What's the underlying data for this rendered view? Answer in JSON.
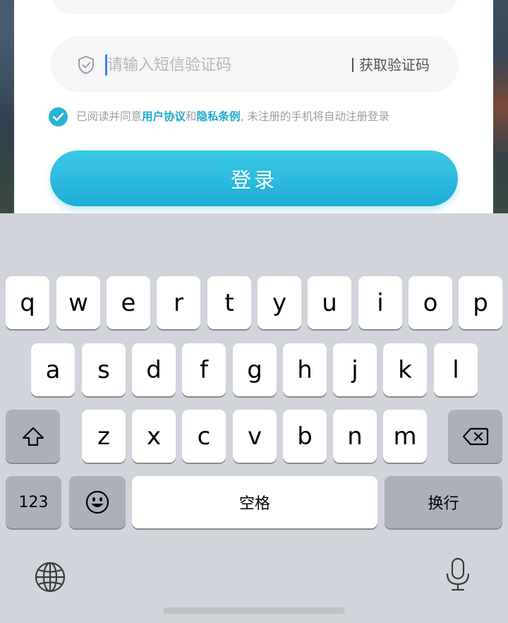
{
  "login": {
    "code_placeholder": "请输入短信验证码",
    "get_code_label": "获取验证码",
    "agreement_prefix": "已阅读并同意",
    "user_agreement_link": "用户协议",
    "agreement_and": "和",
    "privacy_link": "隐私条例",
    "agreement_suffix": ", 未注册的手机将自动注册登录",
    "agreement_checked": true,
    "login_button_label": "登录",
    "accent_color": "#27b3d8"
  },
  "keyboard": {
    "row1": [
      "q",
      "w",
      "e",
      "r",
      "t",
      "y",
      "u",
      "i",
      "o",
      "p"
    ],
    "row2": [
      "a",
      "s",
      "d",
      "f",
      "g",
      "h",
      "j",
      "k",
      "l"
    ],
    "row3": [
      "z",
      "x",
      "c",
      "v",
      "b",
      "n",
      "m"
    ],
    "numbers_key": "123",
    "emoji_key_icon": "emoji-icon",
    "space_label": "空格",
    "return_label": "换行",
    "shift_icon": "shift-icon",
    "delete_icon": "backspace-icon",
    "globe_icon": "globe-icon",
    "mic_icon": "microphone-icon"
  }
}
